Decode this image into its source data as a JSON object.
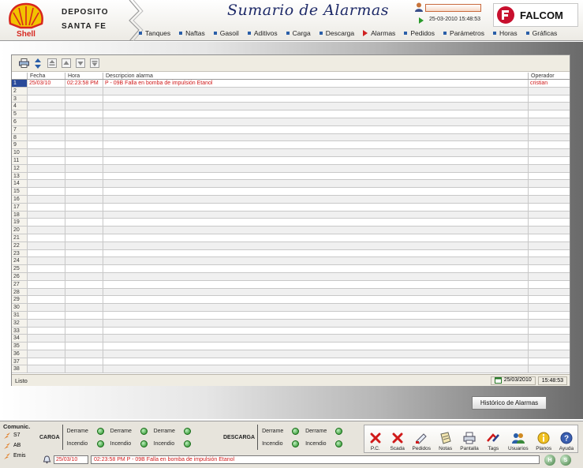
{
  "header": {
    "brand_left": "Shell",
    "site_line1": "DEPOSITO",
    "site_line2": "SANTA FE",
    "title": "Sumario de Alarmas",
    "user_value": "",
    "datetime": "25-03-2010 15:48:53",
    "brand_right": "FALCOM"
  },
  "menu": [
    {
      "label": "Tanques",
      "active": false
    },
    {
      "label": "Naftas",
      "active": false
    },
    {
      "label": "Gasoil",
      "active": false
    },
    {
      "label": "Aditivos",
      "active": false
    },
    {
      "label": "Carga",
      "active": false
    },
    {
      "label": "Descarga",
      "active": false
    },
    {
      "label": "Alarmas",
      "active": true
    },
    {
      "label": "Pedidos",
      "active": false
    },
    {
      "label": "Parámetros",
      "active": false
    },
    {
      "label": "Horas",
      "active": false
    },
    {
      "label": "Gráficas",
      "active": false
    }
  ],
  "grid": {
    "columns": [
      "",
      "Fecha",
      "Hora",
      "Descripcion alarma",
      "Operador"
    ],
    "row_count": 38,
    "rows": [
      {
        "n": "1",
        "fecha": "25/03/10",
        "hora": "02:23:58 PM",
        "desc": "P - 09B  Falla en bomba de impulsión Etanol",
        "op": "cristian"
      }
    ]
  },
  "statusbar": {
    "text": "Listo",
    "date": "25/03/2010",
    "time": "15:48:53"
  },
  "history_button": "Histórico de Alarmas",
  "comms": {
    "title": "Comunic.",
    "items": [
      "S7",
      "AB",
      "Emis"
    ]
  },
  "carga": {
    "label": "CARGA",
    "derrame": "Derrame",
    "incendio": "Incendio"
  },
  "descarga": {
    "label": "DESCARGA",
    "derrame": "Derrame",
    "incendio": "Incendio"
  },
  "tools": [
    {
      "label": "P.C.",
      "icon": "red-x-icon"
    },
    {
      "label": "Scada",
      "icon": "red-x-icon"
    },
    {
      "label": "Pedidos",
      "icon": "truck-icon"
    },
    {
      "label": "Notas",
      "icon": "notepad-icon"
    },
    {
      "label": "Pantalla",
      "icon": "printer-icon"
    },
    {
      "label": "Tags",
      "icon": "tags-icon"
    },
    {
      "label": "Usuarios",
      "icon": "users-icon"
    },
    {
      "label": "Planos",
      "icon": "info-icon"
    },
    {
      "label": "Ayuda",
      "icon": "help-icon"
    }
  ],
  "ticker": {
    "date": "25/03/10",
    "message": "02:23:58 PM  P - 09B  Falla en bomba de impulsión Etanol"
  },
  "nav": [
    "H",
    "S"
  ],
  "colors": {
    "title": "#1e2a68",
    "alarm": "#d01a1a",
    "accent": "#2a4a9a"
  }
}
